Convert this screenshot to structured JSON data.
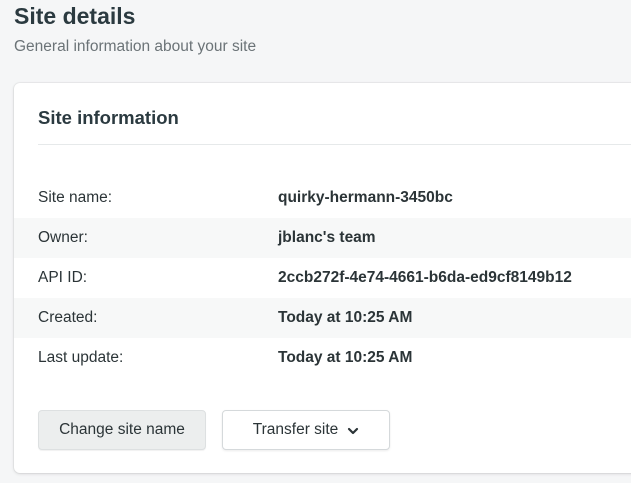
{
  "header": {
    "title": "Site details",
    "subtitle": "General information about your site"
  },
  "card": {
    "title": "Site information",
    "rows": [
      {
        "label": "Site name:",
        "value": "quirky-hermann-3450bc"
      },
      {
        "label": "Owner:",
        "value": "jblanc's team"
      },
      {
        "label": "API ID:",
        "value": "2ccb272f-4e74-4661-b6da-ed9cf8149b12"
      },
      {
        "label": "Created:",
        "value": "Today at 10:25 AM"
      },
      {
        "label": "Last update:",
        "value": "Today at 10:25 AM"
      }
    ]
  },
  "actions": {
    "change_label": "Change site name",
    "transfer_label": "Transfer site",
    "transfer_icon": "chevron-down-icon"
  }
}
